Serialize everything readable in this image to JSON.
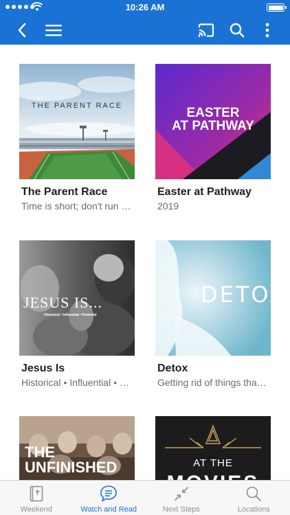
{
  "status_bar": {
    "time": "10:26 AM"
  },
  "header": {
    "back_icon": "chevron-left-icon",
    "menu_icon": "hamburger-menu-icon",
    "cast_icon": "cast-icon",
    "search_icon": "search-icon",
    "more_icon": "more-vertical-icon"
  },
  "colors": {
    "brand": "#1a73d4",
    "tab_inactive": "#8e8e8e",
    "tab_active": "#1a73d4"
  },
  "series": [
    {
      "title": "The Parent Race",
      "subtitle": "Time is short; don't run out of time",
      "art_text": "THE PARENT RACE"
    },
    {
      "title": "Easter at Pathway",
      "subtitle": "2019",
      "art_line1": "EASTER",
      "art_line2": "AT PATHWAY"
    },
    {
      "title": "Jesus Is",
      "subtitle": "Historical • Influential • Powerful",
      "art_text": "JESUS IS...",
      "art_tagline": "Historical • Influential • Powerful"
    },
    {
      "title": "Detox",
      "subtitle": "Getting rid of things that hold you back",
      "art_text": "DETOX"
    },
    {
      "title": "The Unfinished",
      "subtitle": "",
      "art_line1": "THE",
      "art_line2": "UNFINISHED"
    },
    {
      "title": "At the Movies",
      "subtitle": "",
      "art_line1": "AT THE",
      "art_line2": "MOVIES"
    }
  ],
  "tabs": [
    {
      "label": "Weekend",
      "icon": "bible-icon",
      "active": false
    },
    {
      "label": "Watch and Read",
      "icon": "chat-bubble-icon",
      "active": true
    },
    {
      "label": "Next Steps",
      "icon": "arrows-in-icon",
      "active": false
    },
    {
      "label": "Locations",
      "icon": "search-icon",
      "active": false
    }
  ]
}
